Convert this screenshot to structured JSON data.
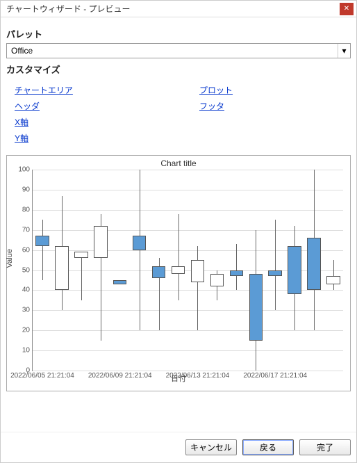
{
  "window": {
    "title": "チャートウィザード - プレビュー"
  },
  "palette": {
    "label": "パレット",
    "selected": "Office"
  },
  "customize": {
    "label": "カスタマイズ",
    "links": {
      "chartArea": "チャートエリア",
      "plot": "プロット",
      "header": "ヘッダ",
      "footer": "フッタ",
      "xaxis": "X軸",
      "yaxis": "Y軸"
    }
  },
  "chart_data": {
    "type": "candlestick",
    "title": "Chart title",
    "xlabel": "日付",
    "ylabel": "Value",
    "ylim": [
      0,
      100
    ],
    "yticks": [
      0,
      10,
      20,
      30,
      40,
      50,
      60,
      70,
      80,
      90,
      100
    ],
    "xticks": [
      "2022/06/05 21:21:04",
      "2022/06/09 21:21:04",
      "2022/06/13 21:21:04",
      "2022/06/17 21:21:04"
    ],
    "series": [
      {
        "x": "2022/06/05",
        "low": 45,
        "high": 75,
        "open": 62,
        "close": 67,
        "up": true
      },
      {
        "x": "2022/06/06",
        "low": 30,
        "high": 87,
        "open": 62,
        "close": 40,
        "up": false
      },
      {
        "x": "2022/06/07",
        "low": 35,
        "high": 59,
        "open": 56,
        "close": 59,
        "up": false
      },
      {
        "x": "2022/06/08",
        "low": 15,
        "high": 78,
        "open": 56,
        "close": 72,
        "up": false
      },
      {
        "x": "2022/06/09",
        "low": 43,
        "high": 45,
        "open": 43,
        "close": 45,
        "up": true
      },
      {
        "x": "2022/06/10",
        "low": 20,
        "high": 100,
        "open": 60,
        "close": 67,
        "up": true
      },
      {
        "x": "2022/06/11",
        "low": 20,
        "high": 56,
        "open": 46,
        "close": 52,
        "up": true
      },
      {
        "x": "2022/06/12",
        "low": 35,
        "high": 78,
        "open": 48,
        "close": 52,
        "up": false
      },
      {
        "x": "2022/06/13",
        "low": 20,
        "high": 62,
        "open": 44,
        "close": 55,
        "up": false
      },
      {
        "x": "2022/06/14",
        "low": 35,
        "high": 50,
        "open": 42,
        "close": 48,
        "up": false
      },
      {
        "x": "2022/06/15",
        "low": 40,
        "high": 63,
        "open": 47,
        "close": 50,
        "up": true
      },
      {
        "x": "2022/06/16",
        "low": 0,
        "high": 70,
        "open": 48,
        "close": 15,
        "up": true
      },
      {
        "x": "2022/06/17",
        "low": 30,
        "high": 75,
        "open": 47,
        "close": 50,
        "up": true
      },
      {
        "x": "2022/06/18",
        "low": 20,
        "high": 72,
        "open": 38,
        "close": 62,
        "up": true
      },
      {
        "x": "2022/06/19",
        "low": 20,
        "high": 100,
        "open": 40,
        "close": 66,
        "up": true
      },
      {
        "x": "2022/06/20",
        "low": 40,
        "high": 55,
        "open": 43,
        "close": 47,
        "up": false
      }
    ]
  },
  "buttons": {
    "cancel": "キャンセル",
    "back": "戻る",
    "finish": "完了"
  }
}
